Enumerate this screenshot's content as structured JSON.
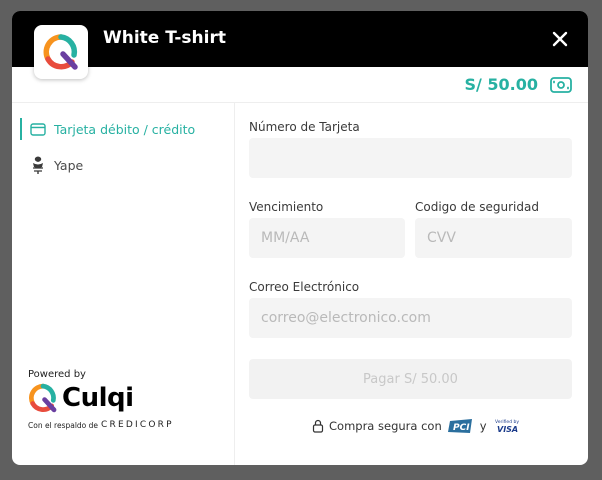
{
  "header": {
    "title": "White T-shirt"
  },
  "amount": {
    "text": "S/ 50.00"
  },
  "sidebar": {
    "items": [
      {
        "label": "Tarjeta débito / crédito",
        "active": true
      },
      {
        "label": "Yape",
        "active": false
      }
    ],
    "powered_by": "Powered by",
    "brand": "Culqi",
    "backing_prefix": "Con el respaldo de",
    "backing_brand": "CREDICORP"
  },
  "form": {
    "card_number_label": "Número de Tarjeta",
    "card_number_value": "",
    "expiry_label": "Vencimiento",
    "expiry_placeholder": "MM/AA",
    "cvv_label": "Codigo de seguridad",
    "cvv_placeholder": "CVV",
    "email_label": "Correo Electrónico",
    "email_placeholder": "correo@electronico.com",
    "pay_button": "Pagar S/ 50.00"
  },
  "footer": {
    "secure_text": "Compra segura con",
    "and": "y",
    "pci_badge": "PCI",
    "visa_top": "Verified by",
    "visa_main": "VISA"
  },
  "colors": {
    "accent": "#27b1a2",
    "header_bg": "#000000",
    "logo_orange": "#f7931e",
    "logo_purple": "#6a3fa0",
    "logo_teal": "#27b1a2"
  }
}
